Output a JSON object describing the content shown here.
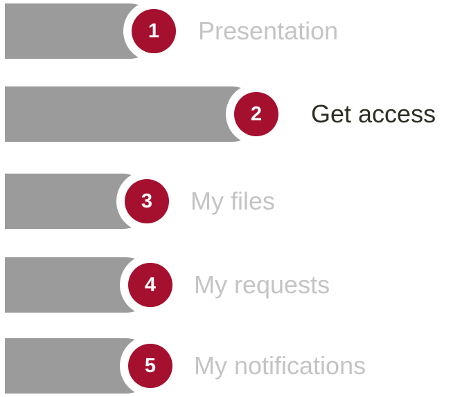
{
  "steps": [
    {
      "number": "1",
      "label": "Presentation",
      "active": false
    },
    {
      "number": "2",
      "label": "Get access",
      "active": true
    },
    {
      "number": "3",
      "label": "My files",
      "active": false
    },
    {
      "number": "4",
      "label": "My requests",
      "active": false
    },
    {
      "number": "5",
      "label": "My notifications",
      "active": false
    }
  ],
  "colors": {
    "bar": "#9b9b9b",
    "badge": "#a5102f",
    "badge_text": "#ffffff",
    "active_label": "#2e2e24",
    "inactive_label": "#c4c4c4"
  }
}
